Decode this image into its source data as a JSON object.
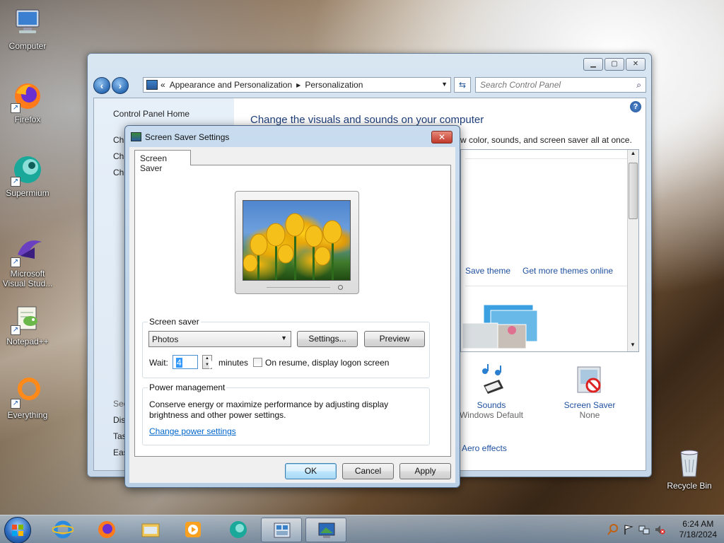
{
  "desktop": {
    "icons": [
      {
        "label": "Computer",
        "icon": "computer-icon"
      },
      {
        "label": "Firefox",
        "icon": "firefox-icon"
      },
      {
        "label": "Supermium",
        "icon": "supermium-icon"
      },
      {
        "label": "Microsoft Visual Stud...",
        "icon": "visual-studio-icon"
      },
      {
        "label": "Notepad++",
        "icon": "notepadpp-icon"
      },
      {
        "label": "Everything",
        "icon": "everything-icon"
      },
      {
        "label": "Recycle Bin",
        "icon": "recycle-bin-icon"
      }
    ]
  },
  "control_panel": {
    "address": {
      "prefix": "«",
      "crumbs": [
        "Appearance and Personalization",
        "Personalization"
      ]
    },
    "search_placeholder": "Search Control Panel",
    "left": {
      "home": "Control Panel Home",
      "links_top": [
        "Ch",
        "Ch",
        "Ch"
      ],
      "see_also": "See",
      "links_bottom": [
        "Dis",
        "Tas",
        "Eas"
      ]
    },
    "title": "Change the visuals and sounds on your computer",
    "subtitle": "w color, sounds, and screen saver all at once.",
    "theme_links": {
      "save": "Save theme",
      "more": "Get more themes online"
    },
    "bottom": {
      "sounds": {
        "label": "Sounds",
        "sub": "Windows Default"
      },
      "screensaver": {
        "label": "Screen Saver",
        "sub": "None"
      },
      "aero": "Aero effects"
    }
  },
  "dialog": {
    "title": "Screen Saver Settings",
    "tab": "Screen Saver",
    "screen_saver_group": "Screen saver",
    "selected_saver": "Photos",
    "settings_btn": "Settings...",
    "preview_btn": "Preview",
    "wait_label": "Wait:",
    "wait_value": "4",
    "minutes_label": "minutes",
    "logon_checkbox": "On resume, display logon screen",
    "logon_checked": false,
    "power_group": "Power management",
    "power_text_1": "Conserve energy or maximize performance by adjusting display",
    "power_text_2": "brightness and other power settings.",
    "power_link": "Change power settings",
    "ok": "OK",
    "cancel": "Cancel",
    "apply": "Apply"
  },
  "taskbar": {
    "time": "6:24 AM",
    "date": "7/18/2024",
    "pinned": [
      "internet-explorer-icon",
      "firefox-icon",
      "file-explorer-icon",
      "media-player-icon",
      "supermium-icon",
      "control-panel-icon",
      "screen-saver-settings-icon"
    ]
  }
}
